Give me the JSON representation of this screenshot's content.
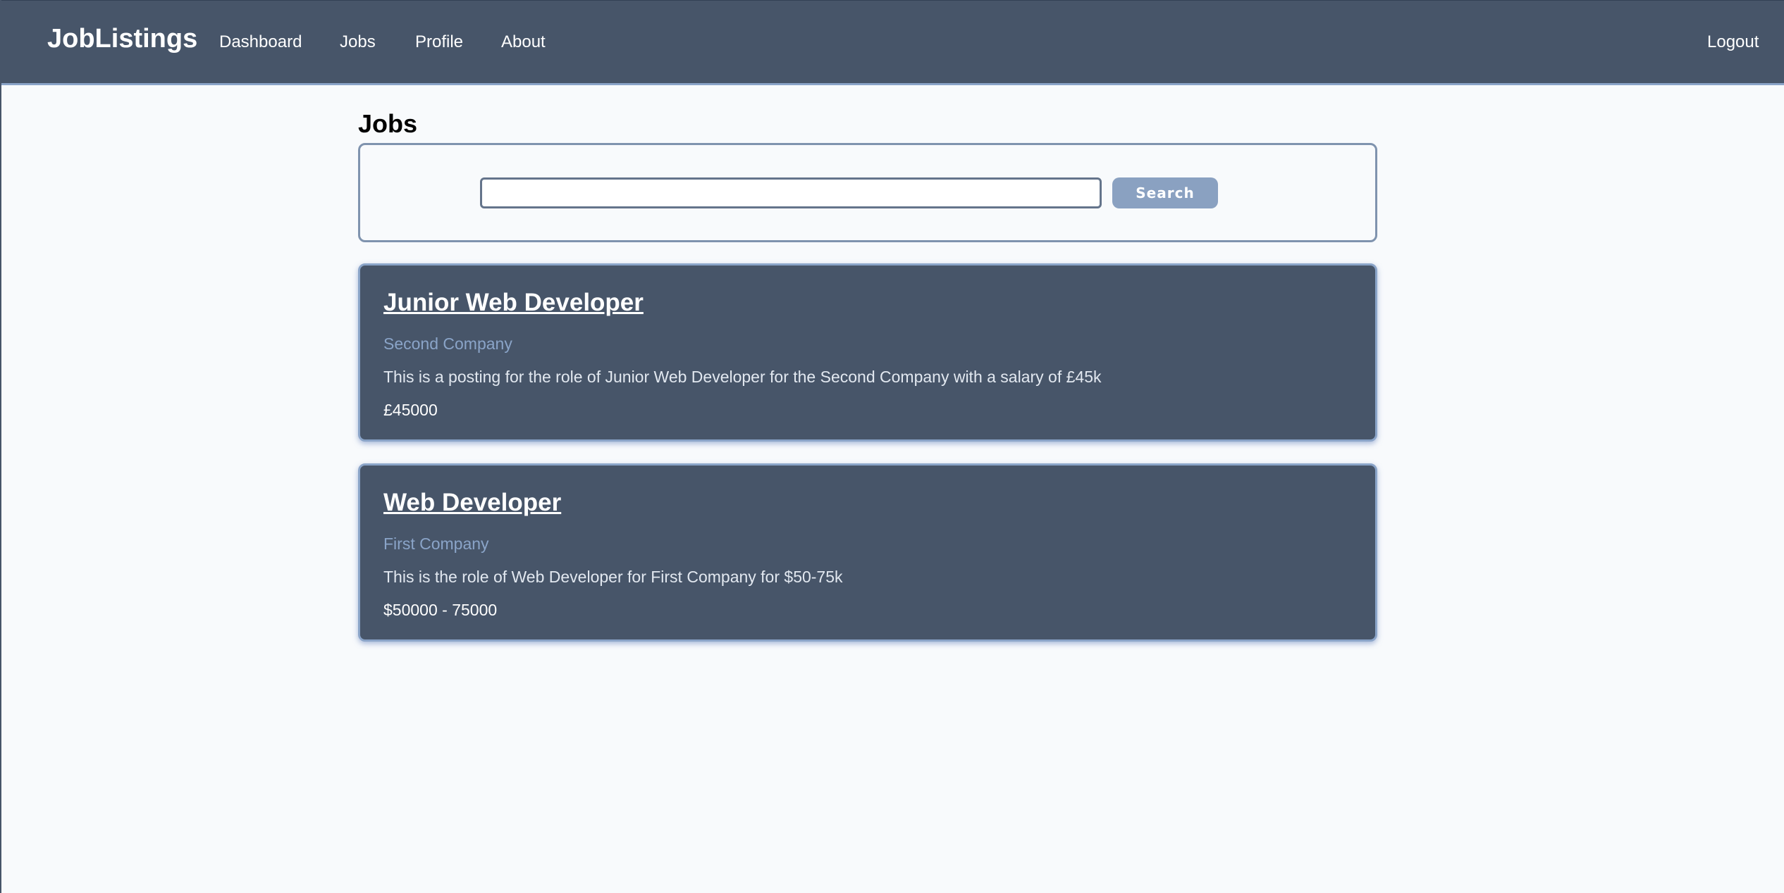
{
  "colors": {
    "navbar_bg": "#475569",
    "accent": "#8aa4c8",
    "page_bg": "#f8fafc",
    "card_bg": "#475569",
    "button_bg": "#8aa1c1"
  },
  "navbar": {
    "brand": "JobListings",
    "links": [
      {
        "label": "Dashboard"
      },
      {
        "label": "Jobs"
      },
      {
        "label": "Profile"
      },
      {
        "label": "About"
      }
    ],
    "logout_label": "Logout"
  },
  "main": {
    "title": "Jobs",
    "search": {
      "value": "",
      "placeholder": "",
      "button_label": "Search"
    },
    "jobs": [
      {
        "title": "Junior Web Developer",
        "company": "Second Company",
        "description": "This is a posting for the role of Junior Web Developer for the Second Company with a salary of £45k",
        "salary": "£45000"
      },
      {
        "title": "Web Developer",
        "company": "First Company",
        "description": "This is the role of Web Developer for First Company for $50-75k",
        "salary": "$50000 - 75000"
      }
    ]
  }
}
